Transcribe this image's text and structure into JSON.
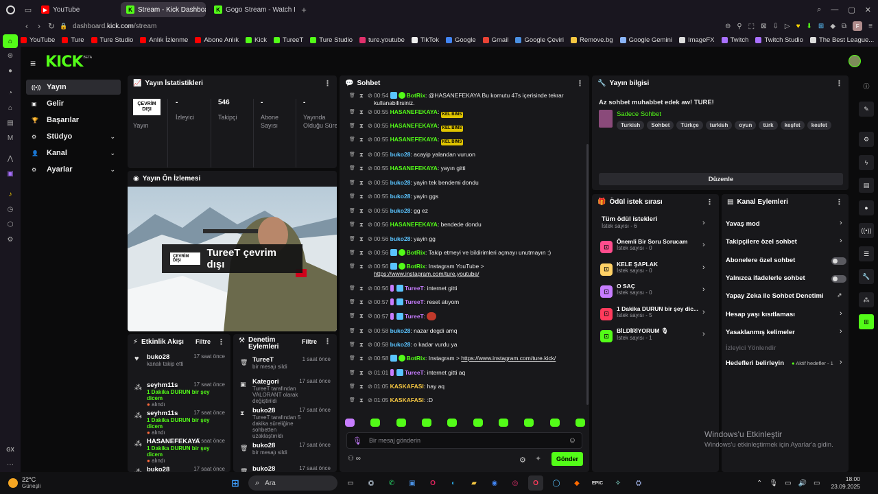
{
  "tabs": [
    {
      "label": "YouTube",
      "active": false
    },
    {
      "label": "Stream - Kick Dashboard",
      "active": true
    },
    {
      "label": "Gogo Stream - Watch Live",
      "active": false
    }
  ],
  "address": {
    "prefix": "dashboard.",
    "domain": "kick.com",
    "path": "/stream"
  },
  "bookmarks": [
    "YouTube",
    "Ture",
    "Ture Studio",
    "Anlık İzlenme",
    "Abone Anlık",
    "Kick",
    "TureeT",
    "Ture Studio",
    "ture.youtube",
    "TikTok",
    "Google",
    "Gmail",
    "Google Çeviri",
    "Remove.bg",
    "Google Gemini",
    "ImageFX",
    "Twitch",
    "Twitch Studio",
    "The Best League..."
  ],
  "logo": {
    "text": "KICK",
    "beta": "BETA"
  },
  "sidebar": {
    "items": [
      {
        "label": "Yayın",
        "icon": "broadcast-icon",
        "selected": true,
        "chevron": false
      },
      {
        "label": "Gelir",
        "icon": "dollar-icon",
        "selected": false,
        "chevron": false
      },
      {
        "label": "Başarılar",
        "icon": "trophy-icon",
        "selected": false,
        "chevron": false
      },
      {
        "label": "Stüdyo",
        "icon": "studio-icon",
        "selected": false,
        "chevron": true
      },
      {
        "label": "Kanal",
        "icon": "user-icon",
        "selected": false,
        "chevron": true
      },
      {
        "label": "Ayarlar",
        "icon": "gear-icon",
        "selected": false,
        "chevron": true
      }
    ]
  },
  "stats": {
    "title": "Yayın İstatistikleri",
    "status_badge": "ÇEVRİM DIŞI",
    "status_label": "Yayın",
    "items": [
      {
        "value": "-",
        "label": "İzleyici"
      },
      {
        "value": "546",
        "label": "Takipçi"
      },
      {
        "value": "-",
        "label": "Abone Sayısı"
      },
      {
        "value": "-",
        "label": "Yayında Olduğu Süre"
      }
    ]
  },
  "preview": {
    "title": "Yayın Ön İzlemesi",
    "badge": "ÇEVRİM DIŞI",
    "text": "TureeT çevrim dışı"
  },
  "activity": {
    "title": "Etkinlik Akışı",
    "filter": "Filtre",
    "items": [
      {
        "name": "buko28",
        "sub": "kanalı takip etti",
        "sub2": "",
        "ago": "17 saat önce"
      },
      {
        "name": "seyhm11s",
        "sub": "1 Dakika DURUN bir şey dicem",
        "sub2": "alındı",
        "ago": "17 saat önce"
      },
      {
        "name": "seyhm11s",
        "sub": "1 Dakika DURUN bir şey dicem",
        "sub2": "alındı",
        "ago": "17 saat önce"
      },
      {
        "name": "HASANEFEKAYA",
        "sub": "1 Dakika DURUN bir şey dicem",
        "sub2": "alındı",
        "ago": "17 saat önce"
      },
      {
        "name": "buko28",
        "sub": "",
        "sub2": "",
        "ago": "17 saat önce"
      }
    ]
  },
  "moderation": {
    "title1": "Denetim",
    "title2": "Eylemleri",
    "filter": "Filtre",
    "items": [
      {
        "name": "TureeT",
        "sub": "bir mesajı sildi",
        "ago": "1 saat önce"
      },
      {
        "name": "Kategori",
        "sub": "TureeT tarafından VALORANT olarak değiştirildi",
        "ago": "17 saat önce"
      },
      {
        "name": "buko28",
        "sub": "TureeT tarafından 5 dakika süreliğine sohbetten uzaklaştırıldı",
        "ago": "17 saat önce"
      },
      {
        "name": "buko28",
        "sub": "bir mesajı sildi",
        "ago": "17 saat önce"
      },
      {
        "name": "buko28",
        "sub": "",
        "ago": "17 saat önce"
      }
    ]
  },
  "chat": {
    "title": "Sohbet",
    "placeholder": "Bir mesaj gönderin",
    "send": "Gönder",
    "messages": [
      {
        "time": "00:54",
        "user": "BotRix",
        "color": "green",
        "text": "@HASANEFEKAYA Bu komutu 47s içerisinde tekrar kullanabilirsiniz.",
        "bot": true
      },
      {
        "time": "00:55",
        "user": "HASANEFEKAYA",
        "color": "green",
        "text": "",
        "emote": "KEL BIMS"
      },
      {
        "time": "00:55",
        "user": "HASANEFEKAYA",
        "color": "green",
        "text": "",
        "emote": "KEL BIMS"
      },
      {
        "time": "00:55",
        "user": "HASANEFEKAYA",
        "color": "green",
        "text": "",
        "emote": "KEL BIMS"
      },
      {
        "time": "00:55",
        "user": "buko28",
        "color": "blue",
        "text": "acayip yalandan vuruon"
      },
      {
        "time": "00:55",
        "user": "HASANEFEKAYA",
        "color": "green",
        "text": "yayın gitti"
      },
      {
        "time": "00:55",
        "user": "buko28",
        "color": "blue",
        "text": "yayin tek bendemi dondu"
      },
      {
        "time": "00:55",
        "user": "buko28",
        "color": "blue",
        "text": "yayin ggs"
      },
      {
        "time": "00:55",
        "user": "buko28",
        "color": "blue",
        "text": "gg ez"
      },
      {
        "time": "00:56",
        "user": "HASANEFEKAYA",
        "color": "green",
        "text": "bendede dondu"
      },
      {
        "time": "00:56",
        "user": "buko28",
        "color": "blue",
        "text": "yayin gg"
      },
      {
        "time": "00:56",
        "user": "BotRix",
        "color": "green",
        "text": "Takip etmeyi ve bildirimleri açmayı unutmayın :)",
        "bot": true
      },
      {
        "time": "00:56",
        "user": "BotRix",
        "color": "green",
        "text": "Instagram YouTube >",
        "link": "https://www.instagram.com/ture.youtube/",
        "bot": true
      },
      {
        "time": "00:56",
        "user": "TureeT",
        "color": "purple",
        "text": "internet gitti"
      },
      {
        "time": "00:57",
        "user": "TureeT",
        "color": "purple",
        "text": "reset atıyom"
      },
      {
        "time": "00:57",
        "user": "TureeT",
        "color": "purple",
        "text": ""
      },
      {
        "time": "00:58",
        "user": "buko28",
        "color": "blue",
        "text": "nazar degdi amq"
      },
      {
        "time": "00:58",
        "user": "buko28",
        "color": "blue",
        "text": "o kadar vurdu ya"
      },
      {
        "time": "00:58",
        "user": "BotRix",
        "color": "green",
        "text": "Instagram >",
        "link": "https://www.instagram.com/ture.kick/",
        "bot": true
      },
      {
        "time": "01:01",
        "user": "TureeT",
        "color": "purple",
        "text": "internet gitti aq"
      },
      {
        "time": "01:05",
        "user": "KASKAFASI",
        "color": "yellow",
        "text": "hay aq"
      },
      {
        "time": "01:05",
        "user": "KASKAFASI",
        "color": "yellow",
        "text": ":D"
      }
    ]
  },
  "info": {
    "title": "Yayın bilgisi",
    "stream_title": "Az sohbet muhabbet edek aw! TURE!",
    "category": "Sadece Sohbet",
    "tags": [
      "Turkish",
      "Sohbet",
      "Türkçe",
      "turkish",
      "oyun",
      "türk",
      "keşfet",
      "kesfet"
    ],
    "edit": "Düzenle"
  },
  "rewards": {
    "title": "Ödül istek sırası",
    "all": "Tüm ödül istekleri",
    "all_sub": "İstek sayısı - 6",
    "items": [
      {
        "name": "Önemli Bir Soru Sorucam",
        "sub": "İstek sayısı - 0",
        "color": "#ff4d8d"
      },
      {
        "name": "KELE ŞAPLAK",
        "sub": "İstek sayısı - 0",
        "color": "#ffd166"
      },
      {
        "name": "O SAÇ",
        "sub": "İstek sayısı - 0",
        "color": "#c77dff"
      },
      {
        "name": "1 Dakika DURUN bir şey dic...",
        "sub": "İstek sayısı - 5",
        "color": "#ff3b5c"
      },
      {
        "name": "BİLDİRİYORUM 🎙",
        "sub": "İstek sayısı - 1",
        "color": "#53fc18"
      }
    ]
  },
  "channel": {
    "title": "Kanal Eylemleri",
    "items": [
      {
        "label": "Yavaş mod",
        "type": "chevron"
      },
      {
        "label": "Takipçilere özel sohbet",
        "type": "chevron"
      },
      {
        "label": "Abonelere özel sohbet",
        "type": "toggle"
      },
      {
        "label": "Yalnızca ifadelerle sohbet",
        "type": "toggle"
      },
      {
        "label": "Yapay Zeka ile Sohbet Denetimi",
        "type": "external"
      },
      {
        "label": "Hesap yaşı kısıtlaması",
        "type": "chevron"
      },
      {
        "label": "Yasaklanmış kelimeler",
        "type": "chevron"
      }
    ],
    "section": "İzleyici Yönlendir",
    "goals": "Hedefleri belirleyin",
    "goals_active": "Aktif hedefler - 1"
  },
  "watermark": {
    "line1": "Windows'u Etkinleştir",
    "line2": "Windows'u etkinleştirmek için Ayarlar'a gidin."
  },
  "taskbar": {
    "weather": "22°C",
    "weather_sub": "Güneşli",
    "search": "Ara",
    "time": "18:00",
    "date": "23.09.2025"
  },
  "colors": {
    "accent": "#53fc18",
    "panel": "#18181b",
    "bg": "#0b0b0c"
  }
}
